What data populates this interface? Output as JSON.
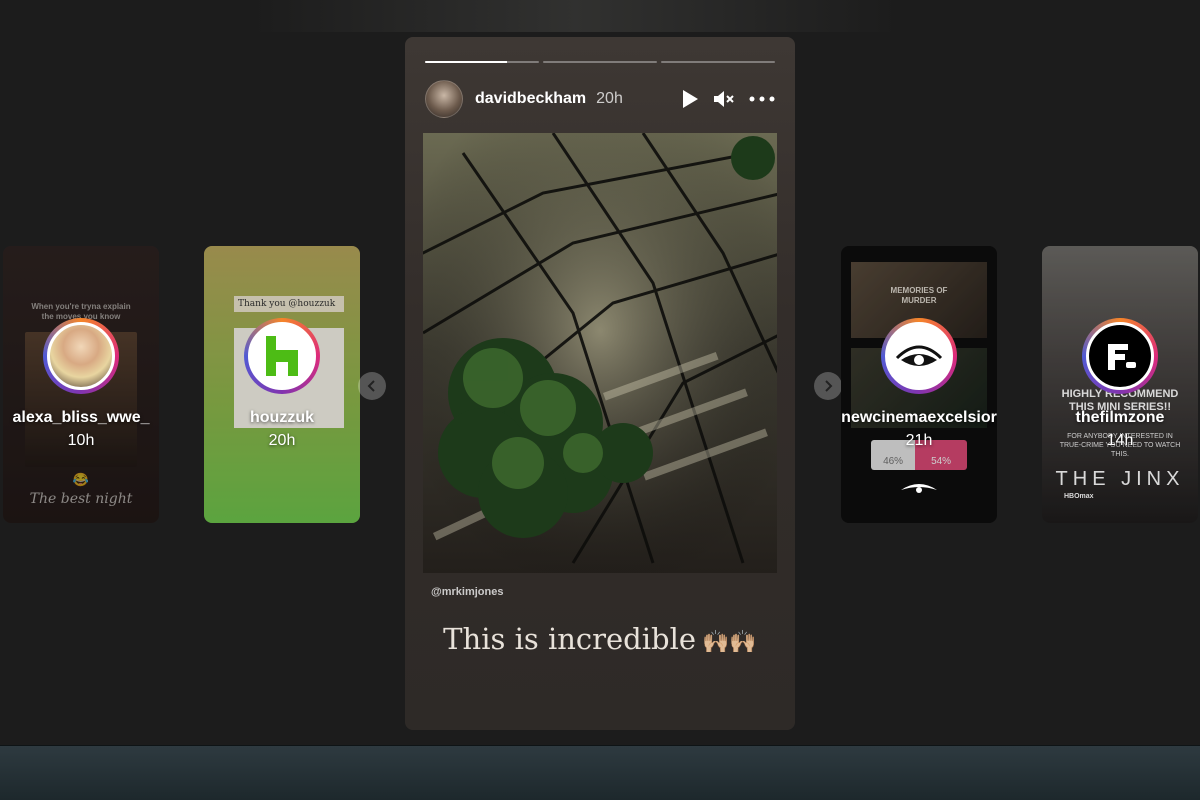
{
  "stories": {
    "previews": [
      {
        "username": "alexa_bliss_wwe_",
        "age": "10h",
        "inner_text": "When you're tryna explain the moves you know",
        "inner_caption": "The best night",
        "emoji": "😂"
      },
      {
        "username": "houzzuk",
        "age": "20h",
        "inner_text": "Thank you @houzzuk",
        "logo_letter": "h"
      },
      {
        "username": "newcinemaexcelsior",
        "age": "21h",
        "inner_text": "MEMORIES OF MURDER",
        "poll_left": "46%",
        "poll_right": "54%"
      },
      {
        "username": "thefilmzone",
        "age": "14h",
        "inner_text": "HIGHLY RECOMMEND THIS MINI SERIES!!",
        "inner_sub": "FOR ANYBODY INTERESTED IN TRUE-CRIME YOU NEED TO WATCH THIS.",
        "inner_title": "THE JINX",
        "inner_network": "HBOmax"
      }
    ],
    "active": {
      "username": "davidbeckham",
      "age": "20h",
      "mention": "@mrkimjones",
      "caption": "This is incredible",
      "caption_emoji": "🙌🏼🙌🏼",
      "progress": [
        1.0,
        0.0,
        0.0
      ],
      "progress_first_fill": 0.72
    }
  },
  "icons": {
    "play": "play-icon",
    "mute": "mute-icon",
    "more": "more-icon",
    "prev": "chevron-left-icon",
    "next": "chevron-right-icon"
  },
  "colors": {
    "background": "#1c1c1c",
    "houzz_green": "#4dbc15"
  }
}
